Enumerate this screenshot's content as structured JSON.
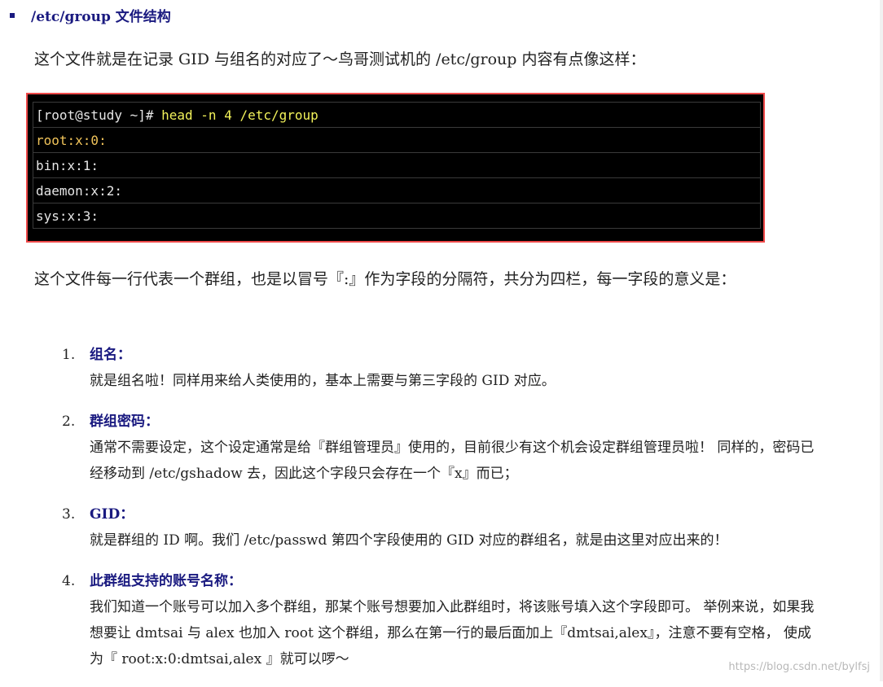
{
  "heading": {
    "text": "/etc/group  文件结构"
  },
  "intro": "这个文件就是在记录 GID 与组名的对应了～鸟哥测试机的 /etc/group 内容有点像这样：",
  "terminal": {
    "prompt": "[root@study ~]# ",
    "command": "head -n 4 /etc/group",
    "lines": [
      "root:x:0:",
      "bin:x:1:",
      "daemon:x:2:",
      "sys:x:3:"
    ]
  },
  "explanation": "这个文件每一行代表一个群组，也是以冒号『:』作为字段的分隔符，共分为四栏，每一字段的意义是：",
  "fields": [
    {
      "num": "1.",
      "title": "组名：",
      "desc": "就是组名啦！同样用来给人类使用的，基本上需要与第三字段的 GID 对应。"
    },
    {
      "num": "2.",
      "title": "群组密码：",
      "desc": "通常不需要设定，这个设定通常是给『群组管理员』使用的，目前很少有这个机会设定群组管理员啦！ 同样的，密码已经移动到 /etc/gshadow 去，因此这个字段只会存在一个『x』而已；"
    },
    {
      "num": "3.",
      "title": "GID：",
      "desc": "就是群组的 ID 啊。我们 /etc/passwd 第四个字段使用的 GID 对应的群组名，就是由这里对应出来的！"
    },
    {
      "num": "4.",
      "title": "此群组支持的账号名称：",
      "desc": "我们知道一个账号可以加入多个群组，那某个账号想要加入此群组时，将该账号填入这个字段即可。 举例来说，如果我想要让 dmtsai 与 alex 也加入 root 这个群组，那么在第一行的最后面加上『dmtsai,alex』，注意不要有空格， 使成为『 root:x:0:dmtsai,alex 』就可以啰～"
    }
  ],
  "watermark": "https://blog.csdn.net/bylfsj"
}
